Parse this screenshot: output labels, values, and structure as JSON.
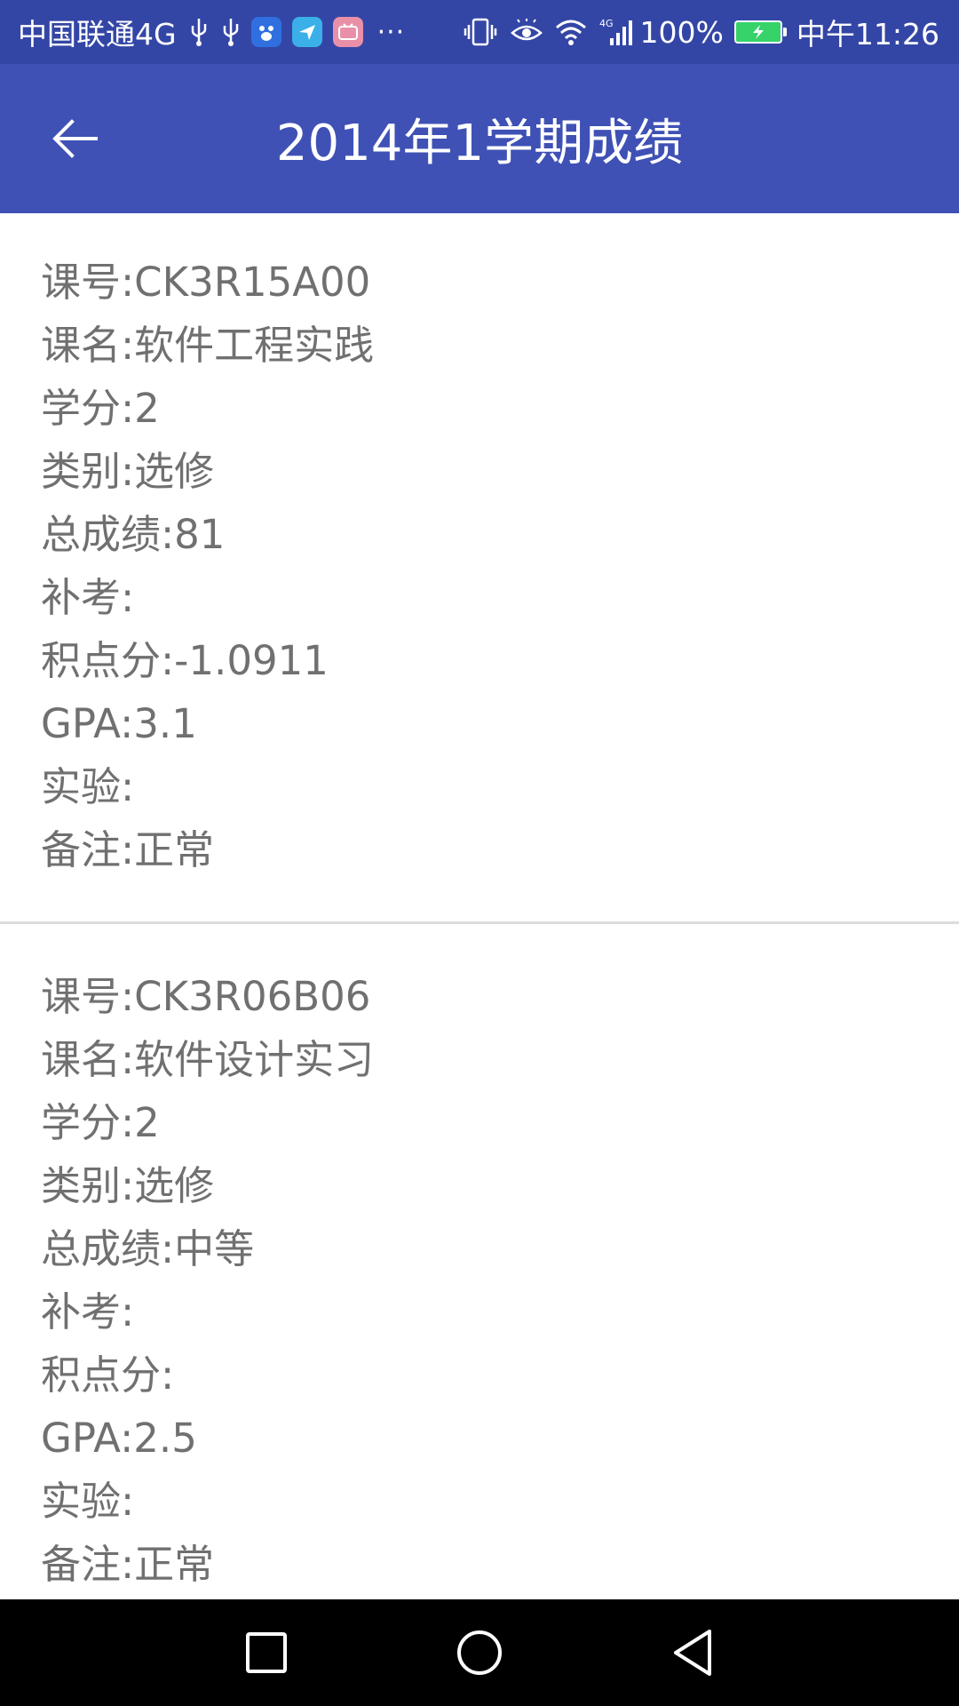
{
  "status_bar": {
    "carrier": "中国联通4G",
    "more": "···",
    "battery": "100%",
    "time": "中午11:26",
    "network_badge": "4G",
    "icons": [
      "usb-icon",
      "usb-icon",
      "baidu-app-icon",
      "map-app-icon",
      "bilibili-app-icon",
      "vibrate-icon",
      "eye-comfort-icon",
      "wifi-icon",
      "signal-icon",
      "battery-charging-icon"
    ],
    "colors": {
      "background": "#3446a5",
      "battery_fill": "#36d36b"
    }
  },
  "app_bar": {
    "title": "2014年1学期成绩",
    "back_icon": "arrow-left-icon",
    "color": "#3f51b5"
  },
  "records": [
    {
      "course_id": "课号:CK3R15A00",
      "course_name": "课名:软件工程实践",
      "credits": "学分:2",
      "category": "类别:选修",
      "total_score": "总成绩:81",
      "makeup": "补考:",
      "grade_points": "积点分:-1.0911",
      "gpa": "GPA:3.1",
      "lab": "实验:",
      "remark": "备注:正常"
    },
    {
      "course_id": "课号:CK3R06B06",
      "course_name": "课名:软件设计实习",
      "credits": "学分:2",
      "category": "类别:选修",
      "total_score": "总成绩:中等",
      "makeup": "补考:",
      "grade_points": "积点分:",
      "gpa": "GPA:2.5",
      "lab": "实验:",
      "remark": "备注:正常"
    }
  ],
  "nav_bar": {
    "icons": [
      "recent-apps-icon",
      "home-icon",
      "back-icon"
    ]
  }
}
